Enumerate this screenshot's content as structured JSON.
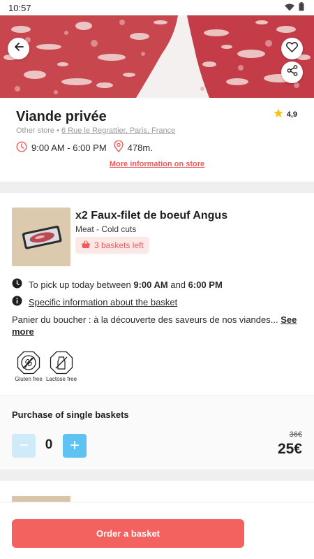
{
  "status_bar": {
    "time": "10:57",
    "icons": [
      "wifi-icon",
      "battery-icon"
    ]
  },
  "hero": {
    "icons": [
      "back-arrow-icon",
      "heart-icon",
      "share-icon"
    ]
  },
  "store": {
    "name": "Viande privée",
    "rating": "4,9",
    "category": "Other store",
    "separator": "•",
    "address": "6 Rue le Regrattier, Paris, France",
    "hours": "9:00 AM - 6:00 PM",
    "distance": "478m.",
    "more_info": "More information on store"
  },
  "basket": {
    "title": "x2 Faux-filet de boeuf Angus",
    "category": "Meat - Cold cuts",
    "baskets_left": "3 baskets left",
    "pickup_prefix": "To pick up today between",
    "pickup_start": "9:00 AM",
    "pickup_and": "and",
    "pickup_end": "6:00 PM",
    "specific_info": "Specific information about the basket",
    "description": "Panier du boucher : à la découverte des saveurs de nos viandes...",
    "see_more": "See more",
    "diet_tags": [
      {
        "label": "Gluten free",
        "icon": "gluten-free-icon"
      },
      {
        "label": "Lactose free",
        "icon": "lactose-free-icon"
      }
    ]
  },
  "purchase": {
    "label": "Purchase of single baskets",
    "minus": "−",
    "plus": "+",
    "quantity": "0",
    "old_price": "36€",
    "new_price": "25€"
  },
  "order_button": "Order a basket",
  "colors": {
    "accent": "#f4625f",
    "link_red": "#f05a5a",
    "stepper_plus": "#5ec3f2",
    "stepper_minus": "#cfeaf8",
    "star": "#f5c518"
  }
}
